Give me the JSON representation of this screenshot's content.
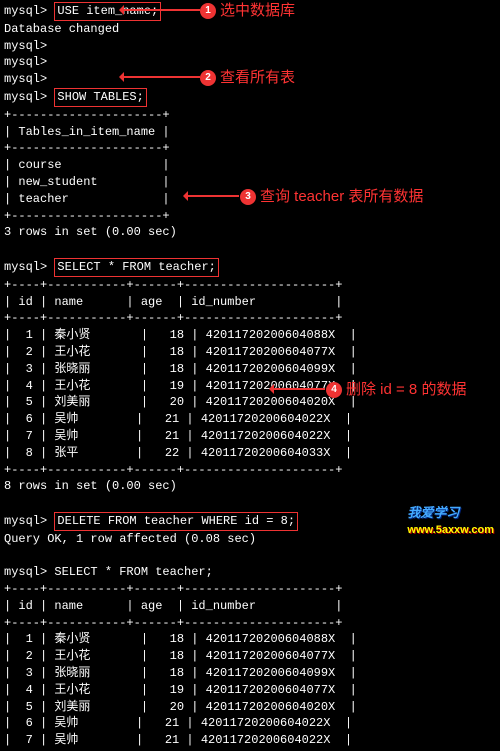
{
  "prompt": "mysql>",
  "cmds": {
    "use": "USE item_name;",
    "db_changed": "Database changed",
    "show_tables": "SHOW TABLES;",
    "select_all": "SELECT * FROM teacher;",
    "delete": "DELETE FROM teacher WHERE id = 8;",
    "delete_resp": "Query OK, 1 row affected (0.08 sec)",
    "rows3": "3 rows in set (0.00 sec)",
    "rows8": "8 rows in set (0.00 sec)"
  },
  "tables_header": "Tables_in_item_name",
  "tables": [
    "course",
    "new_student",
    "teacher"
  ],
  "cols": {
    "id": "id",
    "name": "name",
    "age": "age",
    "idn": "id_number"
  },
  "rows_before": [
    {
      "id": "1",
      "name": "秦小贤",
      "age": "18",
      "idn": "42011720200604088X"
    },
    {
      "id": "2",
      "name": "王小花",
      "age": "18",
      "idn": "42011720200604077X"
    },
    {
      "id": "3",
      "name": "张晓丽",
      "age": "18",
      "idn": "42011720200604099X"
    },
    {
      "id": "4",
      "name": "王小花",
      "age": "19",
      "idn": "42011720200604077X"
    },
    {
      "id": "5",
      "name": "刘美丽",
      "age": "20",
      "idn": "42011720200604020X"
    },
    {
      "id": "6",
      "name": "吴帅",
      "age": "21",
      "idn": "42011720200604022X"
    },
    {
      "id": "7",
      "name": "吴帅",
      "age": "21",
      "idn": "42011720200604022X"
    },
    {
      "id": "8",
      "name": "张平",
      "age": "22",
      "idn": "42011720200604033X"
    }
  ],
  "rows_after": [
    {
      "id": "1",
      "name": "秦小贤",
      "age": "18",
      "idn": "42011720200604088X"
    },
    {
      "id": "2",
      "name": "王小花",
      "age": "18",
      "idn": "42011720200604077X"
    },
    {
      "id": "3",
      "name": "张晓丽",
      "age": "18",
      "idn": "42011720200604099X"
    },
    {
      "id": "4",
      "name": "王小花",
      "age": "19",
      "idn": "42011720200604077X"
    },
    {
      "id": "5",
      "name": "刘美丽",
      "age": "20",
      "idn": "42011720200604020X"
    },
    {
      "id": "6",
      "name": "吴帅",
      "age": "21",
      "idn": "42011720200604022X"
    },
    {
      "id": "7",
      "name": "吴帅",
      "age": "21",
      "idn": "42011720200604022X"
    }
  ],
  "ann": {
    "a1": "选中数据库",
    "a2": "查看所有表",
    "a3": "查询 teacher 表所有数据",
    "a4": "删除 id = 8 的数据"
  },
  "wm": {
    "cn": "我爱学习",
    "en": "www.5axxw.com"
  }
}
